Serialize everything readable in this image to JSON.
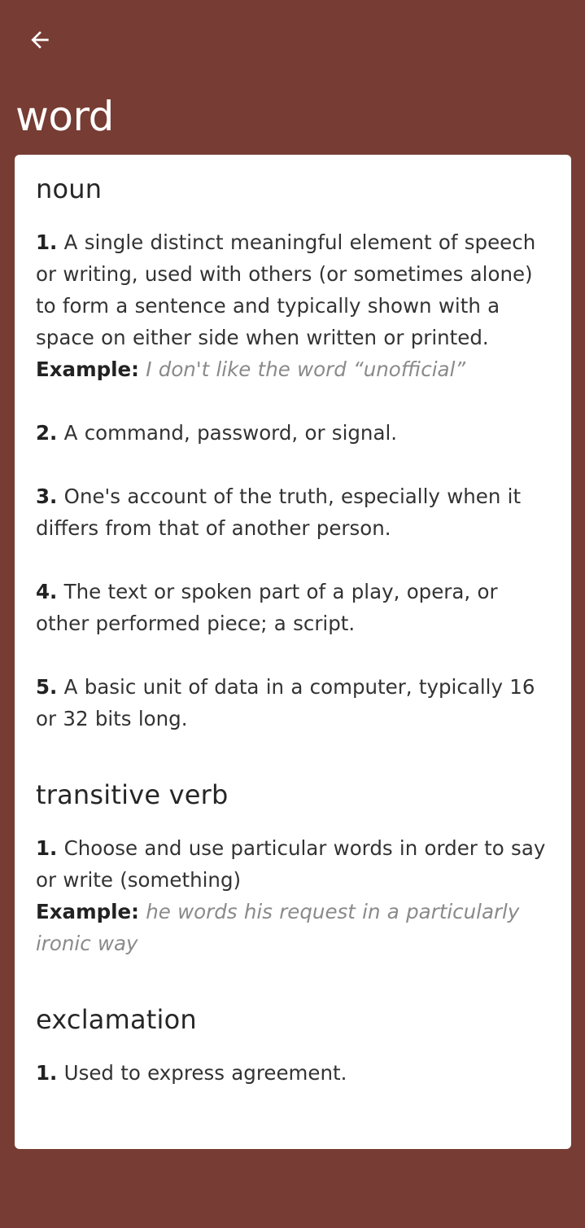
{
  "header": {
    "back_icon": "arrow-left-icon",
    "title": "word"
  },
  "colors": {
    "background": "#773c33",
    "card": "#ffffff",
    "example_text": "#8a8a8a"
  },
  "sections": [
    {
      "pos": "noun",
      "definitions": [
        {
          "num": "1.",
          "text": "A single distinct meaningful element of speech or writing, used with others (or sometimes alone) to form a sentence and typically shown with a space on either side when written or printed.",
          "example_label": "Example:",
          "example": "I don't like the word “unofficial”"
        },
        {
          "num": "2.",
          "text": "A command, password, or signal."
        },
        {
          "num": "3.",
          "text": "One's account of the truth, especially when it differs from that of another person."
        },
        {
          "num": "4.",
          "text": "The text or spoken part of a play, opera, or other performed piece; a script."
        },
        {
          "num": "5.",
          "text": "A basic unit of data in a computer, typically 16 or 32 bits long."
        }
      ]
    },
    {
      "pos": "transitive verb",
      "definitions": [
        {
          "num": "1.",
          "text": "Choose and use particular words in order to say or write (something)",
          "example_label": "Example:",
          "example": "he words his request in a particularly ironic way"
        }
      ]
    },
    {
      "pos": "exclamation",
      "definitions": [
        {
          "num": "1.",
          "text": "Used to express agreement."
        }
      ]
    }
  ]
}
